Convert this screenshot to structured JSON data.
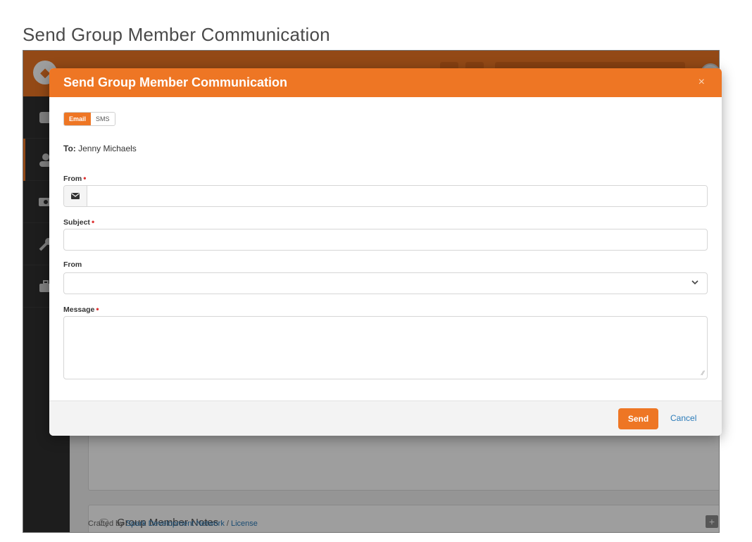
{
  "page": {
    "heading": "Send Group Member Communication"
  },
  "background": {
    "panel_notes_title": "Group Member Notes",
    "footer_prefix": "Crafted by ",
    "footer_link": "Spark Development Network",
    "footer_sep": " / ",
    "footer_license": "License"
  },
  "modal": {
    "title": "Send Group Member Communication",
    "close_label": "×",
    "toggle": {
      "email": "Email",
      "sms": "SMS",
      "selected": "Email"
    },
    "to_label": "To:",
    "to_value": " Jenny Michaels",
    "from_email_label": "From",
    "subject_label": "Subject",
    "from_select_label": "From",
    "message_label": "Message",
    "required_marker": "•",
    "send_label": "Send",
    "cancel_label": "Cancel"
  },
  "colors": {
    "brand": "#ee7624",
    "link": "#2b7bb9",
    "required": "#dd3333"
  },
  "icons": {
    "email_addon": "envelope-icon",
    "select_caret": "chevron-down-icon"
  }
}
